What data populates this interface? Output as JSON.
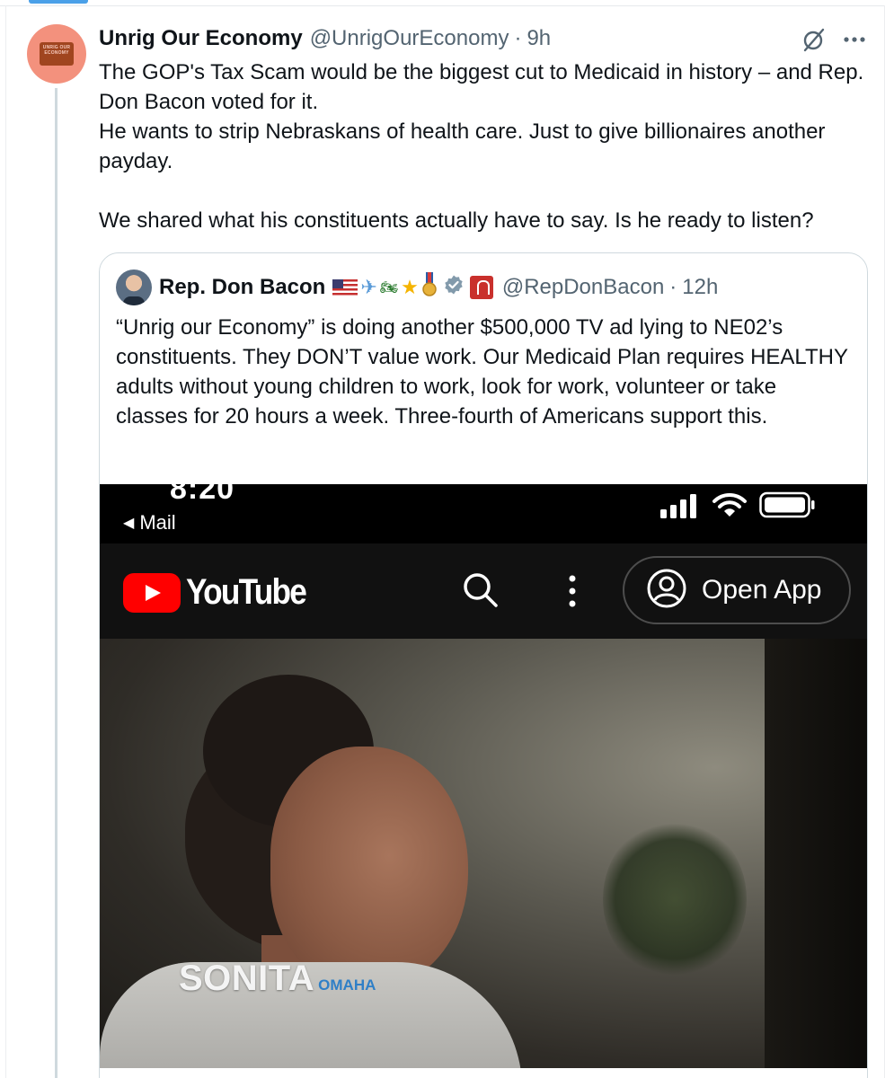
{
  "tweet": {
    "author_name": "Unrig Our Economy",
    "author_handle": "@UnrigOurEconomy",
    "separator": "·",
    "time": "9h",
    "avatar_logo_text": "UNRIG OUR ECONOMY",
    "lines": [
      "The GOP's Tax Scam would be the biggest cut to Medicaid in history – and Rep. Don Bacon voted for it.",
      "He wants to strip Nebraskans of health care. Just to give billionaires another payday.",
      "We shared what his constituents actually have to say. Is he ready to listen?"
    ]
  },
  "quoted": {
    "author_name": "Rep. Don Bacon",
    "author_handle": "@RepDonBacon",
    "separator": "·",
    "time": "12h",
    "name_emoji": [
      "us-flag",
      "airplane",
      "motorcycle",
      "star",
      "medal"
    ],
    "text": "“Unrig our Economy” is doing another $500,000 TV ad lying to NE02’s constituents. They DON’T value work. Our Medicaid Plan requires HEALTHY adults without young children to work, look for work, volunteer or take classes for 20 hours a week. Three-fourth of Americans support this."
  },
  "media": {
    "status_time": "8:20",
    "back_label": "Mail",
    "youtube_word": "YouTube",
    "open_app_label": "Open App",
    "lower_third_name": "SONITA",
    "lower_third_city": "OMAHA"
  },
  "icons": {
    "grok": "grok-icon",
    "more": "more-icon",
    "verified": "verified-badge-icon",
    "government": "government-badge-icon",
    "search": "search-icon",
    "kebab": "kebab-menu-icon",
    "account": "account-circle-icon",
    "signal": "signal-icon",
    "wifi": "wifi-icon",
    "battery": "battery-icon"
  },
  "colors": {
    "text_primary": "#0f1419",
    "text_secondary": "#536471",
    "avatar_bg": "#f3917d",
    "youtube_red": "#ff0000",
    "accent": "#4aa0e8",
    "lower_third_city": "#2f7fc7"
  }
}
